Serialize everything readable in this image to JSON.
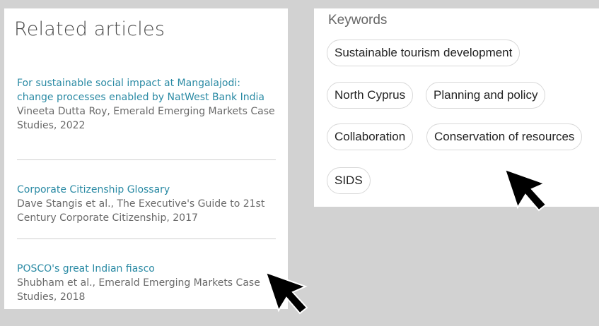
{
  "related": {
    "title": "Related articles",
    "articles": [
      {
        "title": "For sustainable social impact at Mangalajodi: change processes enabled by NatWest Bank India",
        "meta": "Vineeta Dutta Roy, Emerald Emerging Markets Case Studies, 2022"
      },
      {
        "title": "Corporate Citizenship Glossary",
        "meta": "Dave Stangis et al., The Executive's Guide to 21st Century Corporate Citizenship, 2017"
      },
      {
        "title": "POSCO's great Indian fiasco",
        "meta": "Shubham et al., Emerald Emerging Markets Case Studies, 2018"
      }
    ]
  },
  "keywords": {
    "title": "Keywords",
    "tags": [
      "Sustainable tourism development",
      "North Cyprus",
      "Planning and policy",
      "Collaboration",
      "Conservation of resources",
      "SIDS"
    ]
  },
  "colors": {
    "link": "#2a8aa4",
    "background": "#d2d2d2"
  },
  "icons": {
    "cursor": "mouse-pointer-icon"
  }
}
